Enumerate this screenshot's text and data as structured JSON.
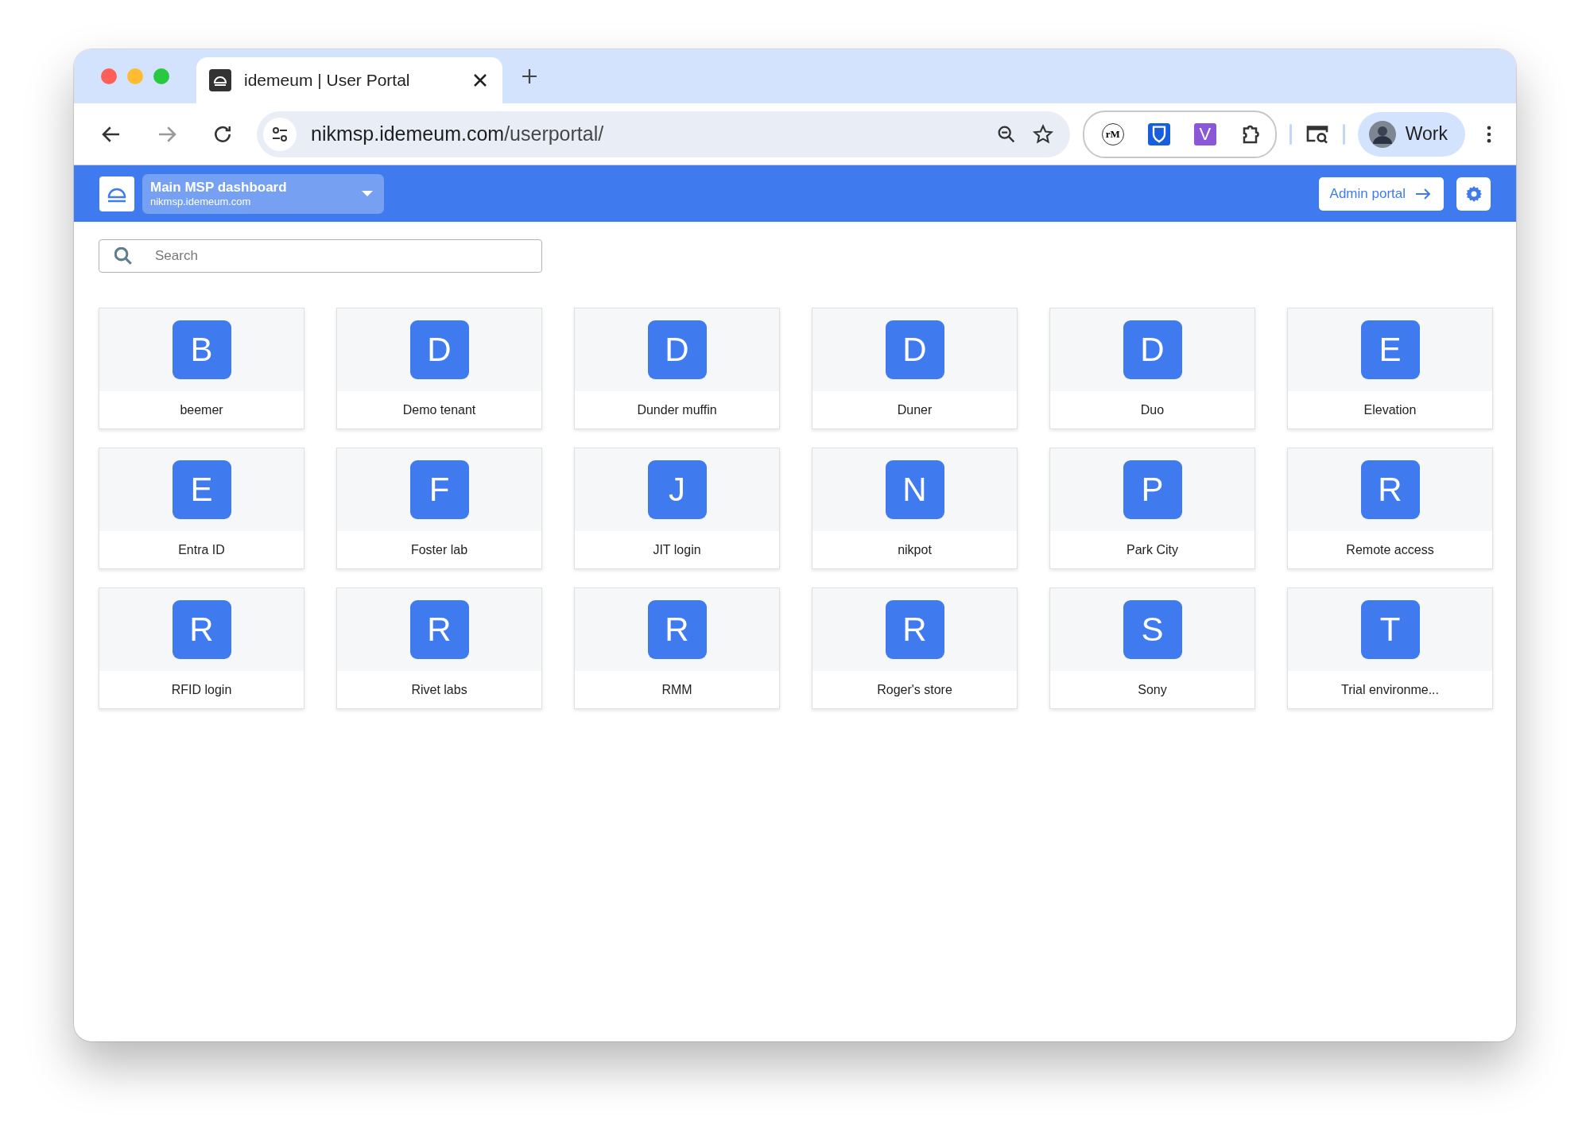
{
  "browser": {
    "tab": {
      "title": "idemeum | User Portal",
      "selected": true
    },
    "url": {
      "host": "nikmsp.idemeum.com",
      "path": "/userportal/"
    },
    "extensions": [
      {
        "kind": "text",
        "label": "rM"
      },
      {
        "kind": "shield"
      },
      {
        "kind": "letter",
        "label": "V"
      },
      {
        "kind": "puzzle"
      }
    ],
    "profile": {
      "label": "Work"
    }
  },
  "header": {
    "workspace": {
      "title": "Main MSP dashboard",
      "subtitle": "nikmsp.idemeum.com"
    },
    "admin_button": "Admin portal"
  },
  "search": {
    "placeholder": "Search"
  },
  "apps": [
    {
      "letter": "B",
      "name": "beemer"
    },
    {
      "letter": "D",
      "name": "Demo tenant"
    },
    {
      "letter": "D",
      "name": "Dunder muffin"
    },
    {
      "letter": "D",
      "name": "Duner"
    },
    {
      "letter": "D",
      "name": "Duo"
    },
    {
      "letter": "E",
      "name": "Elevation"
    },
    {
      "letter": "E",
      "name": "Entra ID"
    },
    {
      "letter": "F",
      "name": "Foster lab"
    },
    {
      "letter": "J",
      "name": "JIT login"
    },
    {
      "letter": "N",
      "name": "nikpot"
    },
    {
      "letter": "P",
      "name": "Park City"
    },
    {
      "letter": "R",
      "name": "Remote access"
    },
    {
      "letter": "R",
      "name": "RFID login"
    },
    {
      "letter": "R",
      "name": "Rivet labs"
    },
    {
      "letter": "R",
      "name": "RMM"
    },
    {
      "letter": "R",
      "name": "Roger's store"
    },
    {
      "letter": "S",
      "name": "Sony"
    },
    {
      "letter": "T",
      "name": "Trial environme..."
    }
  ]
}
